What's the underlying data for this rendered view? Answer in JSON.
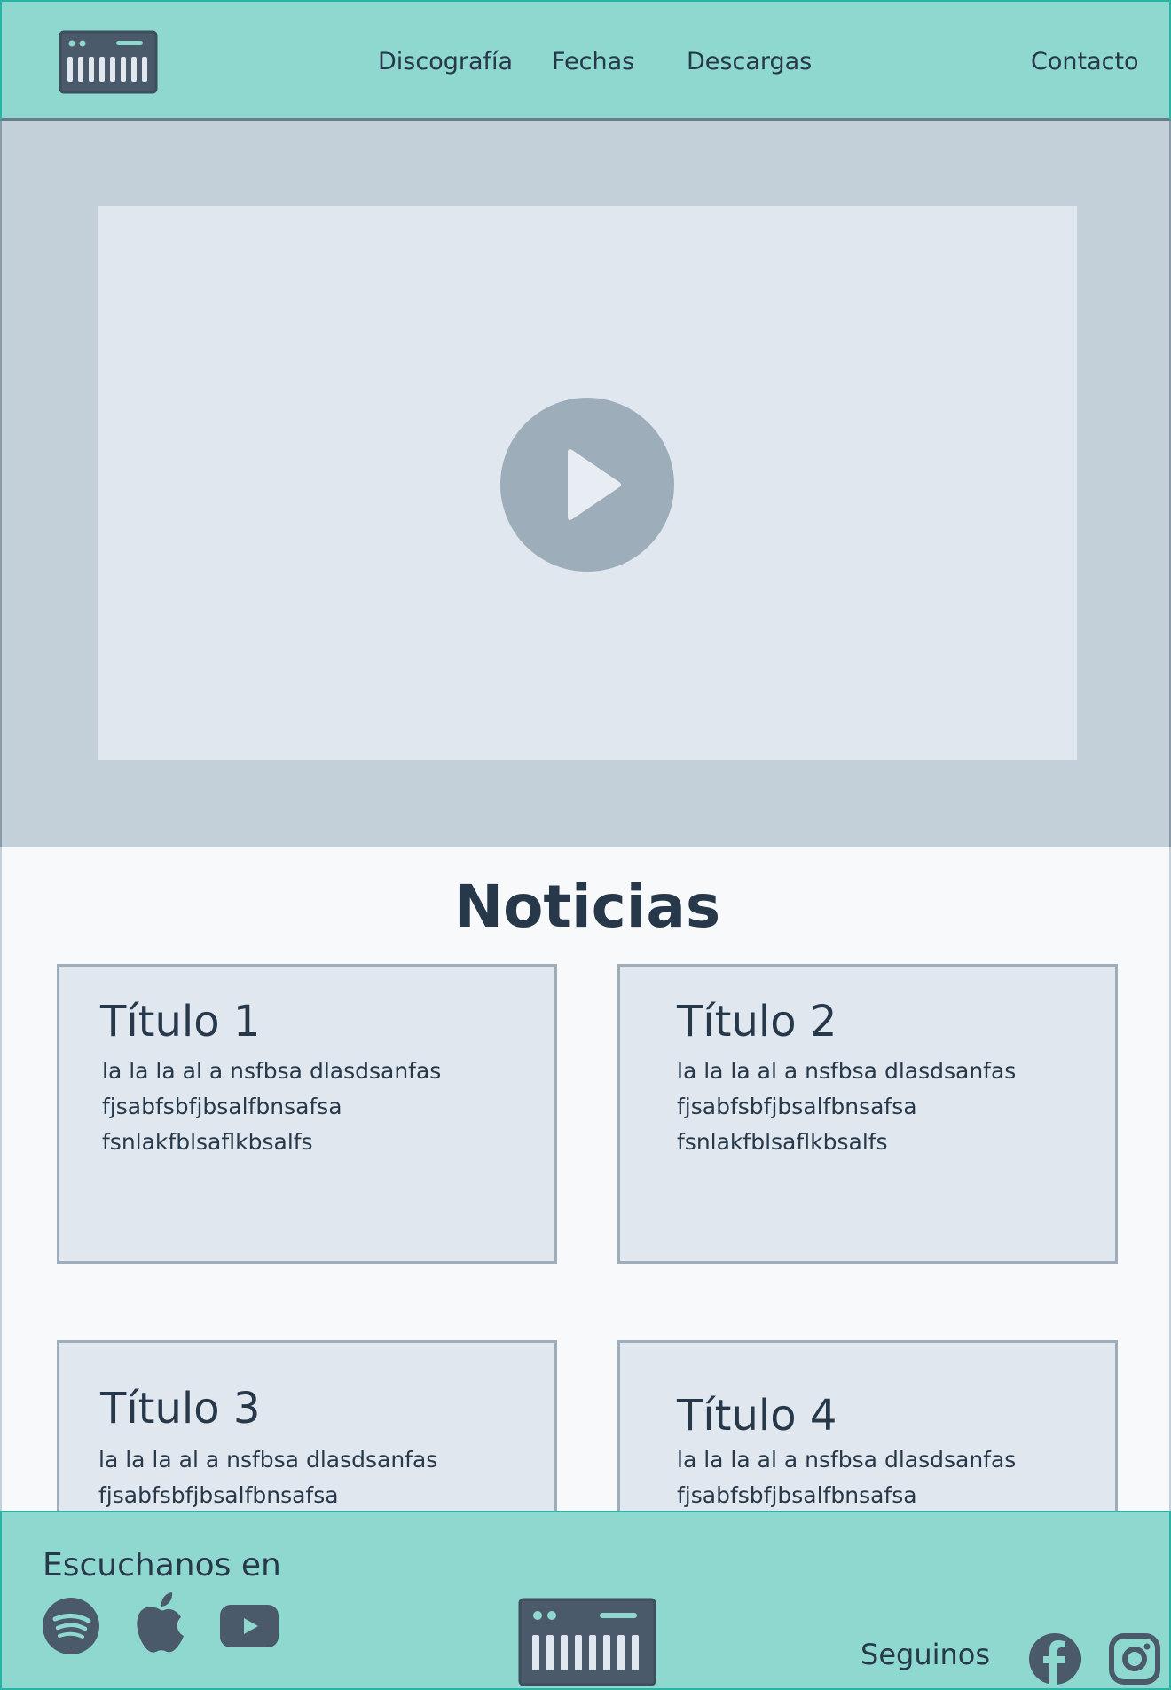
{
  "header": {
    "logo_icon": "piano-keyboard-icon",
    "nav": [
      {
        "label": "Discografía"
      },
      {
        "label": "Fechas"
      },
      {
        "label": "Descargas"
      },
      {
        "label": "Contacto"
      }
    ]
  },
  "hero": {
    "video_icon": "play-icon"
  },
  "news": {
    "title": "Noticias",
    "cards": [
      {
        "title": "Título 1",
        "lines": [
          "la la la al a nsfbsa dlasdsanfas",
          "fjsabfsbfjbsalfbnsafsa",
          "fsnlakfblsaflkbsalfs"
        ]
      },
      {
        "title": "Título 2",
        "lines": [
          "la la la al a nsfbsa dlasdsanfas",
          "fjsabfsbfjbsalfbnsafsa",
          "fsnlakfblsaflkbsalfs"
        ]
      },
      {
        "title": "Título 3",
        "lines": [
          "la la la al a nsfbsa dlasdsanfas",
          "fjsabfsbfjbsalfbnsafsa"
        ]
      },
      {
        "title": "Título 4",
        "lines": [
          "la la la al a nsfbsa dlasdsanfas",
          "fjsabfsbfjbsalfbnsafsa"
        ]
      }
    ]
  },
  "footer": {
    "listen_label": "Escuchanos en",
    "listen_icons": [
      "spotify-icon",
      "apple-icon",
      "youtube-icon"
    ],
    "follow_label": "Seguinos",
    "follow_icons": [
      "facebook-icon",
      "instagram-icon"
    ],
    "logo_icon": "piano-keyboard-icon"
  },
  "colors": {
    "header_bg": "#8fd8cf",
    "header_border": "#2bb3a3",
    "hero_bg": "#c3d0d9",
    "video_bg": "#e0e7ef",
    "play_button": "#9dadba",
    "card_bg": "#e0e7ef",
    "card_border": "#9dadba",
    "text": "#27384a",
    "icon": "#4a5a6a"
  }
}
